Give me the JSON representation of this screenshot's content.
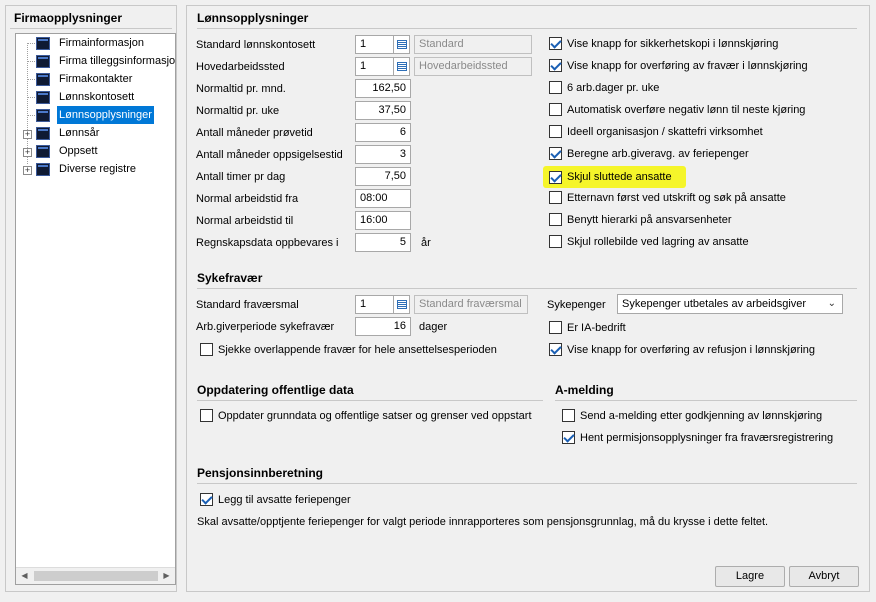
{
  "sidebar": {
    "title": "Firmaopplysninger",
    "items": [
      {
        "label": "Firmainformasjon"
      },
      {
        "label": "Firma tilleggsinformasjon"
      },
      {
        "label": "Firmakontakter"
      },
      {
        "label": "Lønnskontosett"
      },
      {
        "label": "Lønnsopplysninger"
      },
      {
        "label": "Lønnsår"
      },
      {
        "label": "Oppsett"
      },
      {
        "label": "Diverse registre"
      }
    ]
  },
  "lonn": {
    "title": "Lønnsopplysninger",
    "fields": [
      {
        "label": "Standard lønnskontosett",
        "value": "1",
        "lookup": "Standard"
      },
      {
        "label": "Hovedarbeidssted",
        "value": "1",
        "lookup": "Hovedarbeidssted"
      },
      {
        "label": "Normaltid pr. mnd.",
        "value": "162,50"
      },
      {
        "label": "Normaltid pr. uke",
        "value": "37,50"
      },
      {
        "label": "Antall måneder prøvetid",
        "value": "6"
      },
      {
        "label": "Antall måneder oppsigelsestid",
        "value": "3"
      },
      {
        "label": "Antall timer pr dag",
        "value": "7,50"
      },
      {
        "label": "Normal arbeidstid fra",
        "value": "08:00"
      },
      {
        "label": "Normal arbeidstid til",
        "value": "16:00"
      },
      {
        "label": "Regnskapsdata oppbevares i",
        "value": "5",
        "suffix": "år"
      }
    ],
    "checks": [
      {
        "label": "Vise knapp for sikkerhetskopi i lønnskjøring",
        "checked": true
      },
      {
        "label": "Vise knapp for overføring av fravær i lønnskjøring",
        "checked": true
      },
      {
        "label": "6 arb.dager pr. uke",
        "checked": false
      },
      {
        "label": "Automatisk overføre negativ lønn til neste kjøring",
        "checked": false
      },
      {
        "label": "Ideell organisasjon / skattefri virksomhet",
        "checked": false
      },
      {
        "label": "Beregne arb.giveravg. av feriepenger",
        "checked": true
      },
      {
        "label": "Skjul sluttede ansatte",
        "checked": true
      },
      {
        "label": "Etternavn først ved utskrift og søk på ansatte",
        "checked": false
      },
      {
        "label": "Benytt hierarki på ansvarsenheter",
        "checked": false
      },
      {
        "label": "Skjul rollebilde ved lagring av ansatte",
        "checked": false
      }
    ]
  },
  "syk": {
    "title": "Sykefravær",
    "fravaersmal_label": "Standard fraværsmal",
    "fravaersmal_value": "1",
    "fravaersmal_lookup": "Standard fraværsmal",
    "arbgiver_label": "Arb.giverperiode sykefravær",
    "arbgiver_value": "16",
    "arbgiver_suffix": "dager",
    "overlapp_label": "Sjekke overlappende fravær for hele ansettelsesperioden",
    "overlapp_checked": false,
    "sykepenger_label": "Sykepenger",
    "sykepenger_value": "Sykepenger utbetales av arbeidsgiver",
    "ia_label": "Er IA-bedrift",
    "ia_checked": false,
    "refusjon_label": "Vise knapp for overføring av refusjon i lønnskjøring",
    "refusjon_checked": true
  },
  "offentlig": {
    "title": "Oppdatering offentlige data",
    "check_label": "Oppdater grunndata og offentlige satser og grenser ved oppstart",
    "checked": false
  },
  "amelding": {
    "title": "A-melding",
    "checks": [
      {
        "label": "Send a-melding etter godkjenning av lønnskjøring",
        "checked": false
      },
      {
        "label": "Hent permisjonsopplysninger fra fraværsregistrering",
        "checked": true
      }
    ]
  },
  "pensjon": {
    "title": "Pensjonsinnberetning",
    "check_label": "Legg til avsatte feriepenger",
    "checked": true,
    "note": "Skal avsatte/opptjente feriepenger for valgt periode innrapporteres som pensjonsgrunnlag, må du krysse i dette feltet."
  },
  "buttons": {
    "save": "Lagre",
    "cancel": "Avbryt"
  },
  "colors": {
    "selection": "#0078d7",
    "highlight": "#f5f52a",
    "checkmark": "#1a5fb4"
  }
}
